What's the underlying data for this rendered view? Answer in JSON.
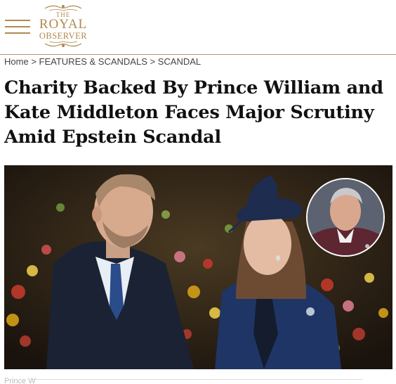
{
  "header": {
    "menu_icon": "hamburger-menu-icon",
    "logo": {
      "the": "THE",
      "royal": "ROYAL",
      "observer": "OBSERVER"
    }
  },
  "breadcrumb": {
    "home": "Home",
    "sep1": ">",
    "section": "FEATURES & SCANDALS",
    "sep2": ">",
    "category": "SCANDAL"
  },
  "article": {
    "title": "Charity Backed By Prince William and Kate Middleton Faces Major Scrutiny Amid Epstein Scandal"
  },
  "caption": {
    "text": "Prince W"
  },
  "colors": {
    "gold": "#b08a4e",
    "title": "#111111"
  }
}
